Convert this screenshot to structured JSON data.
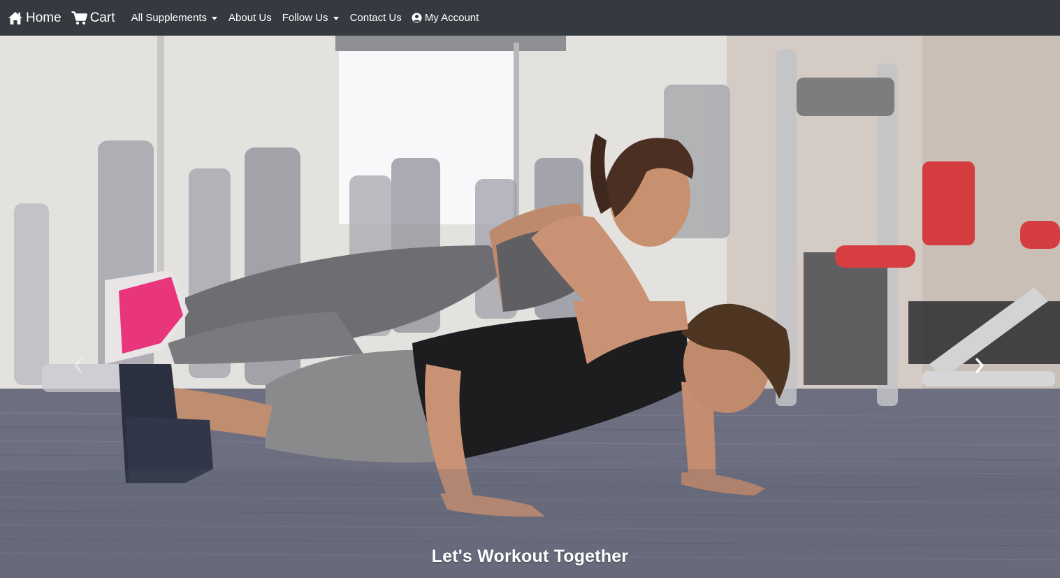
{
  "navbar": {
    "home_label": "Home",
    "cart_label": "Cart",
    "supplements_label": "All Supplements",
    "about_label": "About Us",
    "follow_label": "Follow Us",
    "contact_label": "Contact Us",
    "account_label": "My Account",
    "icons": {
      "home": "home-icon",
      "cart": "cart-icon",
      "account": "user-circle-icon",
      "dropdown": "caret-down-icon"
    }
  },
  "hero": {
    "caption": "Let's Workout Together",
    "controls": {
      "prev": "chevron-left-icon",
      "next": "chevron-right-icon"
    }
  },
  "colors": {
    "navbar_bg": "#343a40",
    "nav_text": "#ffffff",
    "caption_text": "#ffffff",
    "gym_floor": "#6b6d7f",
    "equipment_red": "#d8262b"
  }
}
